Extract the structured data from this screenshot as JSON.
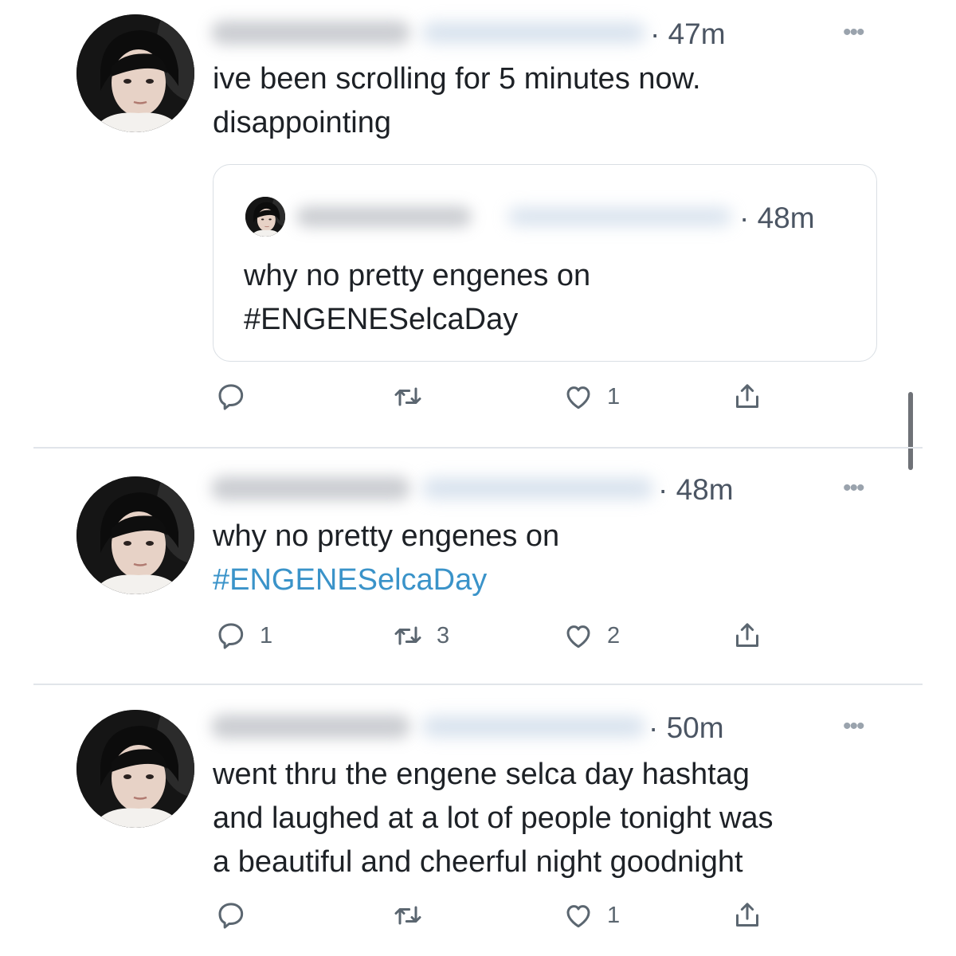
{
  "tweets": [
    {
      "time": "47m",
      "text_lines": [
        "ive been scrolling for 5 minutes now.",
        "disappointing"
      ],
      "quote": {
        "time": "48m",
        "text_lines": [
          "why no pretty engenes on",
          "#ENGENESelcaDay"
        ]
      },
      "reply_count": "",
      "retweet_count": "",
      "like_count": "1"
    },
    {
      "time": "48m",
      "text_line": "why no pretty engenes on",
      "hashtag": "#ENGENESelcaDay",
      "reply_count": "1",
      "retweet_count": "3",
      "like_count": "2"
    },
    {
      "time": "50m",
      "text_lines": [
        "went thru the engene selca day hashtag",
        "and laughed at a lot of people tonight was",
        "a beautiful and cheerful night goodnight"
      ],
      "reply_count": "",
      "retweet_count": "",
      "like_count": "1"
    }
  ],
  "more_label": "•••",
  "colors": {
    "hashtag": "#3a93c9",
    "icon": "#5b6670",
    "divider": "#e1e5ea"
  },
  "icons": [
    "avatar",
    "reply-icon",
    "retweet-icon",
    "like-icon",
    "share-icon",
    "more-icon"
  ]
}
